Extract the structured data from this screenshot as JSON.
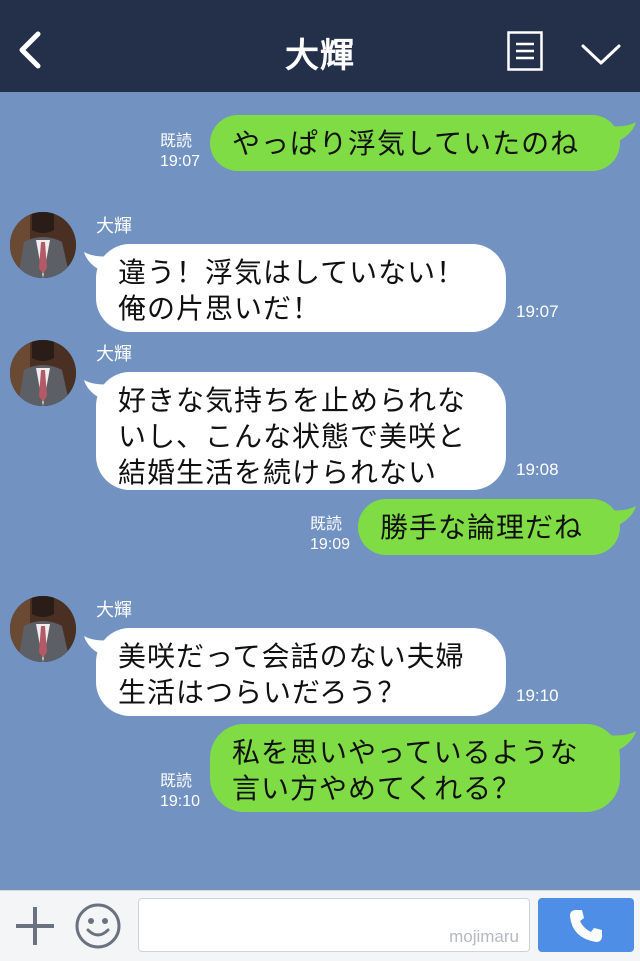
{
  "header": {
    "title": "大輝",
    "back_icon": "chevron-left-icon",
    "menu_icon": "list-icon",
    "collapse_icon": "chevron-down-icon"
  },
  "messages": [
    {
      "from": "me",
      "read_label": "既読",
      "time": "19:07",
      "lines": [
        "やっぱり浮気していたのね"
      ]
    },
    {
      "from": "them",
      "sender": "大輝",
      "time": "19:07",
      "lines": [
        "違う！浮気はしていない！",
        "俺の片思いだ！"
      ]
    },
    {
      "from": "them",
      "sender": "大輝",
      "time": "19:08",
      "lines": [
        "好きな気持ちを止められな",
        "いし、こんな状態で美咲と",
        "結婚生活を続けられない"
      ]
    },
    {
      "from": "me",
      "read_label": "既読",
      "time": "19:09",
      "lines": [
        "勝手な論理だね"
      ]
    },
    {
      "from": "them",
      "sender": "大輝",
      "time": "19:10",
      "lines": [
        "美咲だって会話のない夫婦",
        "生活はつらいだろう？"
      ]
    },
    {
      "from": "me",
      "read_label": "既読",
      "time": "19:10",
      "lines": [
        "私を思いやっているような",
        "言い方やめてくれる？"
      ]
    }
  ],
  "footer": {
    "input_value": "",
    "watermark": "mojimaru",
    "plus_icon": "plus-icon",
    "emoji_icon": "smiley-icon",
    "call_icon": "phone-icon"
  },
  "colors": {
    "header_bg": "#24304a",
    "chat_bg": "#7292c2",
    "my_bubble": "#7fdc45",
    "their_bubble": "#ffffff",
    "call_button": "#4f8ee6"
  }
}
